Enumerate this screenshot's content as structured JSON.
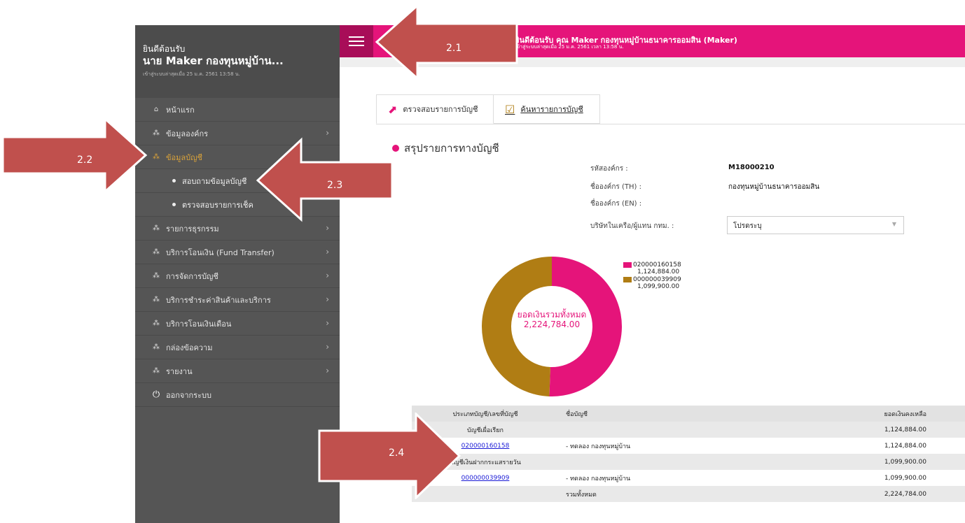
{
  "sidebar": {
    "welcome": "ยินดีต้อนรับ",
    "user": "นาย Maker กองทุนหมู่บ้าน...",
    "last_login": "เข้าสู่ระบบล่าสุดเมื่อ 25 ม.ค. 2561 13:58 น.",
    "items": [
      {
        "label": "หน้าแรก",
        "icon": "home-icon"
      },
      {
        "label": "ข้อมูลองค์กร",
        "icon": "org-icon"
      },
      {
        "label": "ข้อมูลบัญชี",
        "icon": "org-icon"
      },
      {
        "label": "รายการธุรกรรม",
        "icon": "org-icon"
      },
      {
        "label": "บริการโอนเงิน (Fund Transfer)",
        "icon": "org-icon"
      },
      {
        "label": "การจัดการบัญชี",
        "icon": "org-icon"
      },
      {
        "label": "บริการชำระค่าสินค้าและบริการ",
        "icon": "org-icon"
      },
      {
        "label": "บริการโอนเงินเดือน",
        "icon": "org-icon"
      },
      {
        "label": "กล่องข้อความ",
        "icon": "org-icon"
      },
      {
        "label": "รายงาน",
        "icon": "org-icon"
      },
      {
        "label": "ออกจากระบบ",
        "icon": "power-icon"
      }
    ],
    "subitems": [
      {
        "label": "สอบถามข้อมูลบัญชี"
      },
      {
        "label": "ตรวจสอบรายการเช็ค"
      }
    ]
  },
  "topbar": {
    "title": "ยินดีต้อนรับ คุณ Maker กองทุนหมู่บ้านธนาคารออมสิน (Maker)",
    "subtitle": "เข้าสู่ระบบล่าสุดเมื่อ 25 ม.ค. 2561 เวลา 13:58 น."
  },
  "tabs": [
    {
      "label": "ตรวจสอบรายการบัญชี",
      "icon": "chart-icon"
    },
    {
      "label": "ค้นหารายการบัญชี",
      "icon": "calendar-icon"
    }
  ],
  "summary": {
    "title": "สรุปรายการทางบัญชี",
    "org_code_label": "รหัสองค์กร :",
    "org_code": "M18000210",
    "org_name_th_label": "ชื่อองค์กร (TH) :",
    "org_name_th": "กองทุนหมู่บ้านธนาคารออมสิน",
    "org_name_en_label": "ชื่อองค์กร (EN) :",
    "subsidiary_label": "บริษัทในเครือ/ผู้แทน กทม. :",
    "subsidiary_value": "โปรดระบุ"
  },
  "chart_data": {
    "type": "pie",
    "center_label": "ยอดเงินรวมทั้งหมด",
    "center_value": "2,224,784.00",
    "slices": [
      {
        "name": "020000160158",
        "label": "1,124,884.00",
        "value": 1124884.0,
        "color": "#e5147a"
      },
      {
        "name": "000000039909",
        "label": "1,099,900.00",
        "value": 1099900.0,
        "color": "#b07d14"
      }
    ]
  },
  "table": {
    "headers": [
      "ประเภทบัญชี/เลขที่บัญชี",
      "ชื่อบัญชี",
      "ยอดเงินคงเหลือ"
    ],
    "rows": [
      {
        "c1": "บัญชีเผื่อเรียก",
        "c2": "",
        "c3": "1,124,884.00",
        "link": false,
        "grey": true
      },
      {
        "c1": "020000160158",
        "c2": "- ทดลอง กองทุนหมู่บ้าน",
        "c3": "1,124,884.00",
        "link": true,
        "grey": false
      },
      {
        "c1": "บัญชีเงินฝากกระแสรายวัน",
        "c2": "",
        "c3": "1,099,900.00",
        "link": false,
        "grey": true
      },
      {
        "c1": "000000039909",
        "c2": "- ทดลอง กองทุนหมู่บ้าน",
        "c3": "1,099,900.00",
        "link": true,
        "grey": false
      },
      {
        "c1": "",
        "c2": "รวมทั้งหมด",
        "c3": "2,224,784.00",
        "link": false,
        "grey": true
      }
    ]
  },
  "annotations": [
    {
      "label": "2.1"
    },
    {
      "label": "2.2"
    },
    {
      "label": "2.3"
    },
    {
      "label": "2.4"
    }
  ]
}
